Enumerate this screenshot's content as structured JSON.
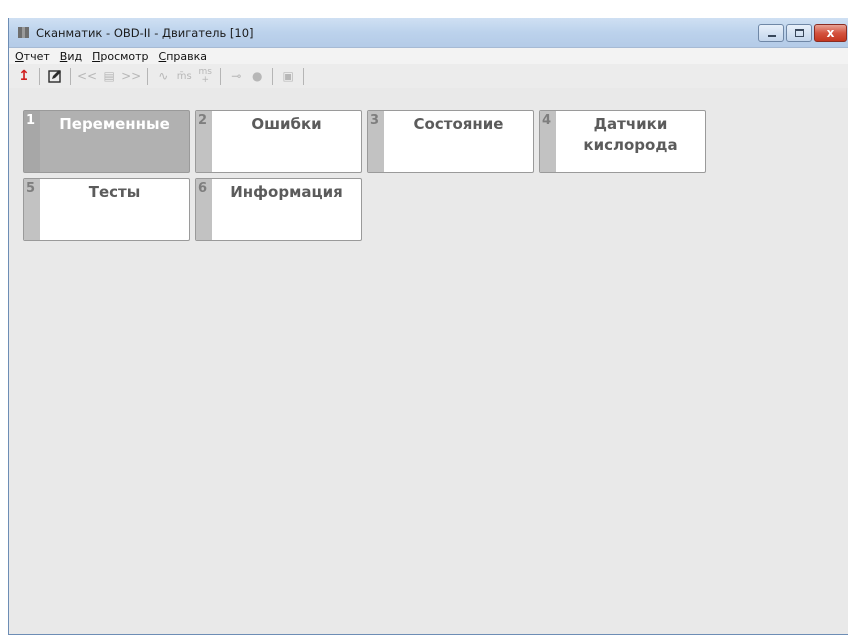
{
  "window": {
    "title": "Сканматик - OBD-II - Двигатель [10]",
    "close_glyph": "x"
  },
  "menu": [
    {
      "accel": "О",
      "rest": "тчет"
    },
    {
      "accel": "В",
      "rest": "ид"
    },
    {
      "accel": "П",
      "rest": "росмотр"
    },
    {
      "accel": "С",
      "rest": "правка"
    }
  ],
  "toolbar": {
    "back": "↥",
    "prev": "<<",
    "list": "▤",
    "next": ">>",
    "wave": "∿",
    "ms_minus": "m̄s",
    "ms_top": "ms",
    "ms_plus": "+",
    "probe": "⊸",
    "record": "●",
    "save": "▣"
  },
  "tiles": [
    {
      "num": "1",
      "label": "Переменные",
      "active": true
    },
    {
      "num": "2",
      "label": "Ошибки"
    },
    {
      "num": "3",
      "label": "Состояние"
    },
    {
      "num": "4",
      "label": "Датчики кислорода"
    },
    {
      "num": "5",
      "label": "Тесты"
    },
    {
      "num": "6",
      "label": "Информация"
    }
  ]
}
